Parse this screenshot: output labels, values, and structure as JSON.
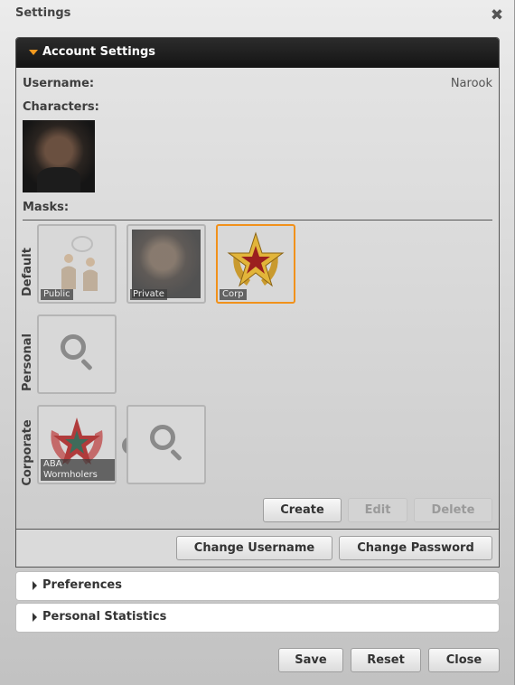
{
  "window": {
    "title": "Settings",
    "close_glyph": "✖"
  },
  "account": {
    "header": "Account Settings",
    "username_label": "Username:",
    "username_value": "Narook",
    "characters_label": "Characters:",
    "masks_label": "Masks:",
    "groups": {
      "default": {
        "label": "Default",
        "masks": [
          {
            "caption": "Public",
            "icon": "people-speech-icon"
          },
          {
            "caption": "Private",
            "icon": "character-portrait"
          },
          {
            "caption": "Corp",
            "icon": "gold-star-emblem-icon",
            "selected": true
          }
        ]
      },
      "personal": {
        "label": "Personal",
        "masks": [
          {
            "icon": "search-icon"
          }
        ]
      },
      "corporate": {
        "label": "Corporate",
        "masks": [
          {
            "caption": "ABA Wormholers",
            "icon": "red-star-emblem-icon",
            "remove_glyph": "✖"
          },
          {
            "icon": "search-icon"
          }
        ]
      }
    },
    "mask_actions": {
      "create": "Create",
      "edit": "Edit",
      "delete": "Delete"
    },
    "footer": {
      "change_username": "Change Username",
      "change_password": "Change Password"
    }
  },
  "sections": {
    "preferences": "Preferences",
    "personal_statistics": "Personal Statistics"
  },
  "actions": {
    "save": "Save",
    "reset": "Reset",
    "close": "Close"
  },
  "colors": {
    "accent": "#f1911b",
    "header_bg": "#1e1e1e",
    "selected_border": "#f1911b"
  }
}
